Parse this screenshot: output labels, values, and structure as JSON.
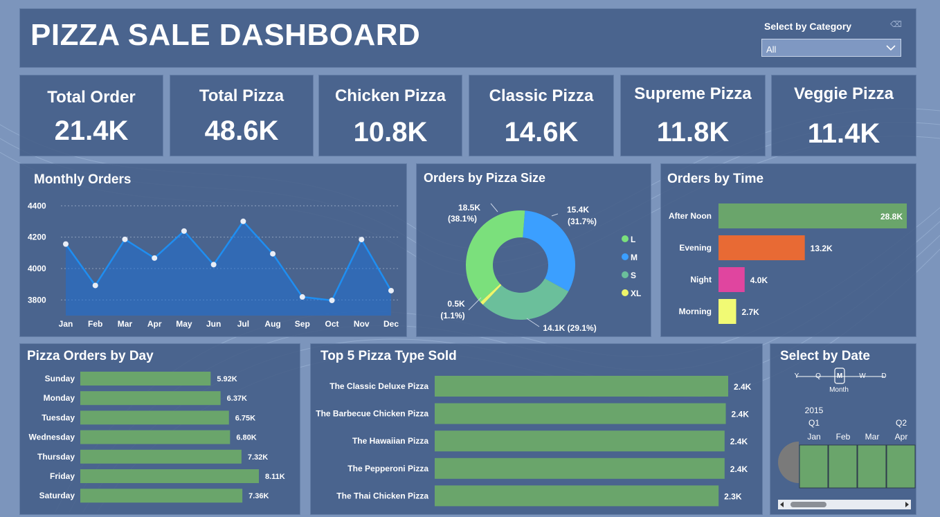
{
  "header": {
    "title": "PIZZA SALE DASHBOARD",
    "category_label": "Select by Category",
    "category_value": "All"
  },
  "kpis": [
    {
      "label": "Total Order",
      "value": "21.4K"
    },
    {
      "label": "Total Pizza",
      "value": "48.6K"
    },
    {
      "label": "Chicken Pizza",
      "value": "10.8K"
    },
    {
      "label": "Classic Pizza",
      "value": "14.6K"
    },
    {
      "label": "Supreme Pizza",
      "value": "11.8K"
    },
    {
      "label": "Veggie Pizza",
      "value": "11.4K"
    }
  ],
  "icons": {
    "dropdown": "chevron-down-icon",
    "eraser": "eraser-icon"
  },
  "colors": {
    "panel": "#425c86",
    "line": "#1f8ef1",
    "bar_green": "#6aa56b",
    "evening": "#e86a34",
    "night": "#e0459f",
    "morning": "#f1fa74",
    "size_L": "#7be07c",
    "size_M": "#3b9fff",
    "size_S": "#6bbf9b",
    "size_XL": "#eef56a"
  },
  "chart_data": [
    {
      "type": "area",
      "title": "Monthly Orders",
      "categories": [
        "Jan",
        "Feb",
        "Mar",
        "Apr",
        "May",
        "Jun",
        "Jul",
        "Aug",
        "Sep",
        "Oct",
        "Nov",
        "Dec"
      ],
      "values": [
        4156,
        3892,
        4186,
        4067,
        4239,
        4025,
        4301,
        4094,
        3819,
        3797,
        4185,
        3859
      ],
      "yticks": [
        "4400",
        "4200",
        "4000",
        "3800"
      ],
      "ylim": [
        3700,
        4450
      ],
      "grid": true
    },
    {
      "type": "pie",
      "title": "Orders by Pizza Size",
      "categories": [
        "L",
        "M",
        "S",
        "XL"
      ],
      "values": [
        18.5,
        15.4,
        14.1,
        0.5
      ],
      "percent": [
        38.1,
        31.7,
        29.1,
        1.1
      ],
      "labels": {
        "L": [
          "18.5K",
          "(38.1%)"
        ],
        "M": [
          "15.4K",
          "(31.7%)"
        ],
        "S": [
          "14.1K (29.1%)"
        ],
        "XL": [
          "0.5K",
          "(1.1%)"
        ]
      },
      "legend": "right"
    },
    {
      "type": "bar",
      "title": "Orders by Time",
      "categories": [
        "After Noon",
        "Evening",
        "Night",
        "Morning"
      ],
      "values": [
        28.8,
        13.2,
        4.0,
        2.7
      ],
      "labels": [
        "28.8K",
        "13.2K",
        "4.0K",
        "2.7K"
      ]
    },
    {
      "type": "bar",
      "title": "Pizza Orders by Day",
      "categories": [
        "Sunday",
        "Monday",
        "Tuesday",
        "Wednesday",
        "Thursday",
        "Friday",
        "Saturday"
      ],
      "values": [
        5.92,
        6.37,
        6.75,
        6.8,
        7.32,
        8.11,
        7.36
      ],
      "labels": [
        "5.92K",
        "6.37K",
        "6.75K",
        "6.80K",
        "7.32K",
        "8.11K",
        "7.36K"
      ]
    },
    {
      "type": "bar",
      "title": "Top 5 Pizza Type Sold",
      "categories": [
        "The Classic Deluxe Pizza",
        "The Barbecue Chicken Pizza",
        "The Hawaiian Pizza",
        "The Pepperoni Pizza",
        "The Thai Chicken Pizza"
      ],
      "values": [
        2.45,
        2.43,
        2.42,
        2.42,
        2.37
      ],
      "labels": [
        "2.4K",
        "2.4K",
        "2.4K",
        "2.4K",
        "2.3K"
      ]
    }
  ],
  "date_slicer": {
    "title": "Select by Date",
    "scale": [
      "Y",
      "Q",
      "M",
      "W",
      "D"
    ],
    "selected_scale_label": "Month",
    "year": "2015",
    "quarters": [
      "Q1",
      "Q2"
    ],
    "months": [
      "Jan",
      "Feb",
      "Mar",
      "Apr"
    ]
  }
}
